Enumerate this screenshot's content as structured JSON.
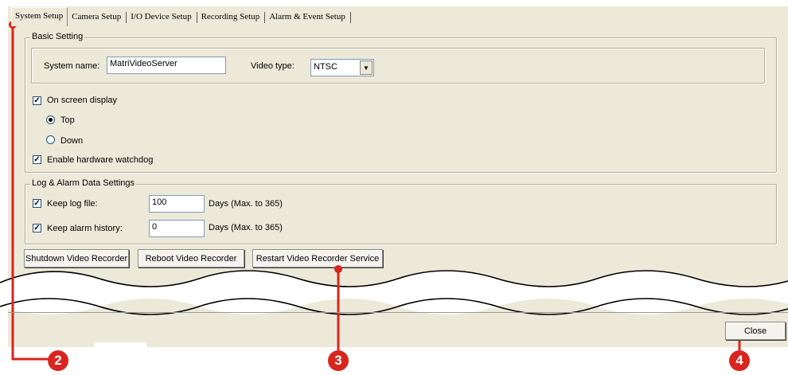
{
  "tabs": [
    "System Setup",
    "Camera Setup",
    "I/O Device Setup",
    "Recording Setup",
    "Alarm & Event Setup"
  ],
  "basic": {
    "legend": "Basic Setting",
    "system_name_label": "System name:",
    "system_name_value": "MatriVideoServer",
    "video_type_label": "Video type:",
    "video_type_value": "NTSC"
  },
  "osd": {
    "label": "On screen display",
    "checked": true,
    "top_label": "Top",
    "down_label": "Down",
    "selected": "Top"
  },
  "watchdog": {
    "label": "Enable hardware watchdog",
    "checked": true
  },
  "log": {
    "legend": "Log & Alarm Data Settings",
    "keep_log_label": "Keep log file:",
    "keep_log_value": "100",
    "keep_log_days": "Days (Max. to 365)",
    "keep_alarm_label": "Keep alarm history:",
    "keep_alarm_value": "0",
    "keep_alarm_days": "Days (Max. to 365)"
  },
  "buttons": {
    "shutdown": "Shutdown Video Recorder",
    "reboot": "Reboot Video Recorder",
    "restart": "Restart Video Recorder Service",
    "close": "Close"
  },
  "callouts": [
    "2",
    "3",
    "4"
  ],
  "colors": {
    "panel": "#ece9d8",
    "callout": "#d8251d"
  }
}
